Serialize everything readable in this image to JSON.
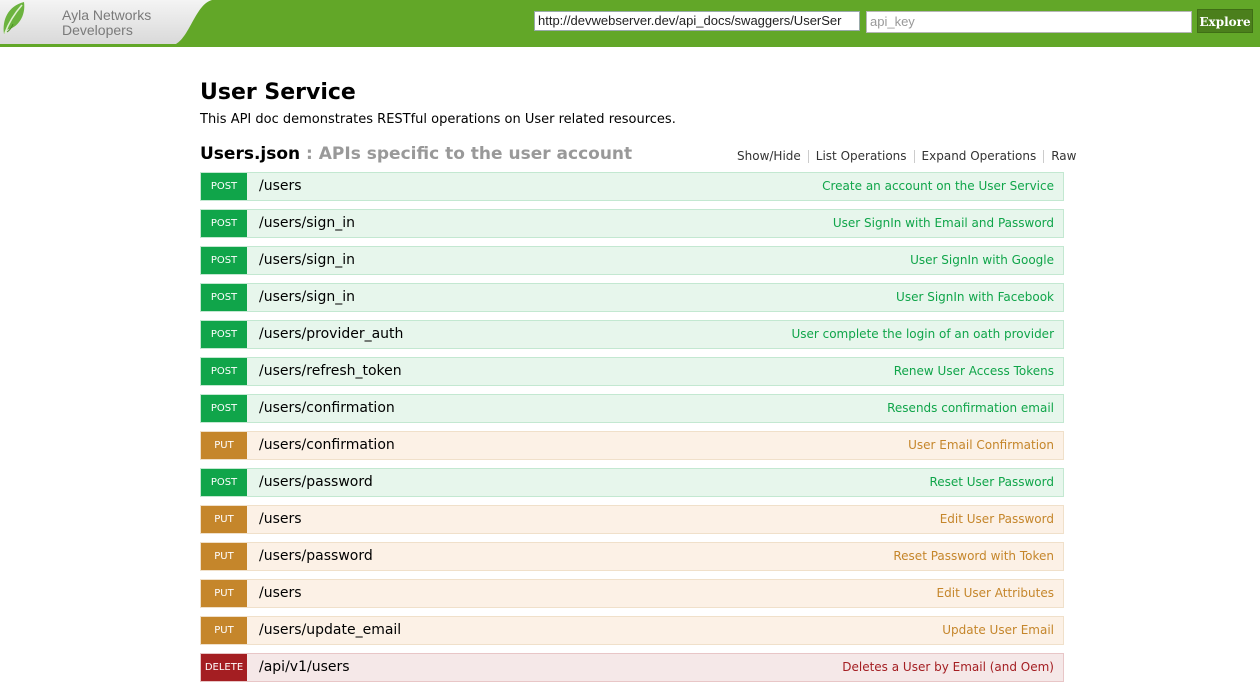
{
  "header": {
    "logo_line1": "Ayla Networks",
    "logo_line2": "Developers",
    "url_value": "http://devwebserver.dev/api_docs/swaggers/UserSer",
    "api_key_placeholder": "api_key",
    "explore_label": "Explore",
    "colors": {
      "bar": "#62a728",
      "explore": "#4b7f1c"
    }
  },
  "main": {
    "title": "User Service",
    "description": "This API doc demonstrates RESTful operations on User related resources.",
    "resource": {
      "name": "Users.json",
      "subtitle": " : APIs specific to the user account",
      "links": [
        "Show/Hide",
        "List Operations",
        "Expand Operations",
        "Raw"
      ]
    },
    "operations": [
      {
        "method": "POST",
        "path": "/users",
        "summary": "Create an account on the User Service"
      },
      {
        "method": "POST",
        "path": "/users/sign_in",
        "summary": "User SignIn with Email and Password"
      },
      {
        "method": "POST",
        "path": "/users/sign_in",
        "summary": "User SignIn with Google"
      },
      {
        "method": "POST",
        "path": "/users/sign_in",
        "summary": "User SignIn with Facebook"
      },
      {
        "method": "POST",
        "path": "/users/provider_auth",
        "summary": "User complete the login of an oath provider"
      },
      {
        "method": "POST",
        "path": "/users/refresh_token",
        "summary": "Renew User Access Tokens"
      },
      {
        "method": "POST",
        "path": "/users/confirmation",
        "summary": "Resends confirmation email"
      },
      {
        "method": "PUT",
        "path": "/users/confirmation",
        "summary": "User Email Confirmation"
      },
      {
        "method": "POST",
        "path": "/users/password",
        "summary": "Reset User Password"
      },
      {
        "method": "PUT",
        "path": "/users",
        "summary": "Edit User Password"
      },
      {
        "method": "PUT",
        "path": "/users/password",
        "summary": "Reset Password with Token"
      },
      {
        "method": "PUT",
        "path": "/users",
        "summary": "Edit User Attributes"
      },
      {
        "method": "PUT",
        "path": "/users/update_email",
        "summary": "Update User Email"
      },
      {
        "method": "DELETE",
        "path": "/api/v1/users",
        "summary": "Deletes a User by Email (and Oem)"
      }
    ],
    "method_colors": {
      "POST": "#10a54a",
      "PUT": "#c5862b",
      "DELETE": "#a41e22"
    }
  }
}
